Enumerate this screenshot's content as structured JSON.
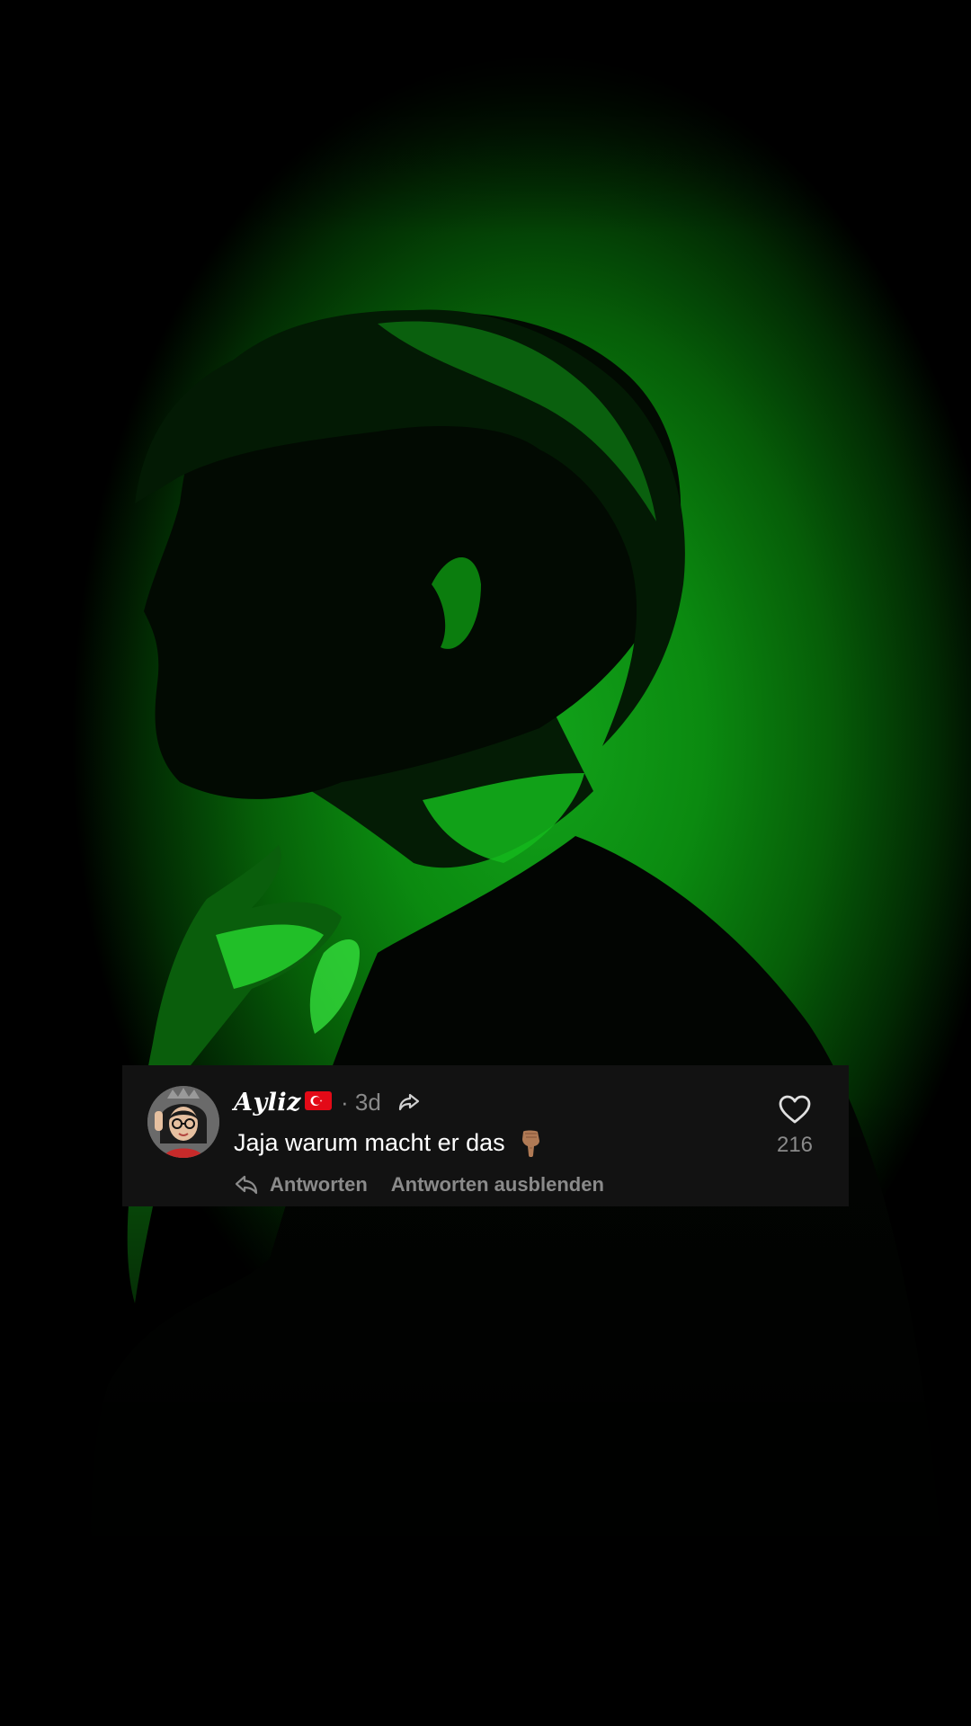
{
  "comment": {
    "username": "𝑨𝒚𝒍𝒊𝒛",
    "timestamp": "· 3d",
    "text": "Jaja warum macht er das",
    "reply_label": "Antworten",
    "hide_replies_label": "Antworten ausblenden",
    "like_count": "216",
    "icons": {
      "avatar": "avatar-bitmoji",
      "flag": "turkey-flag-icon",
      "share": "share-arrow-icon",
      "emoji": "hand-pointing-down-emoji",
      "reply": "reply-arrow-icon",
      "like": "heart-outline-icon"
    }
  },
  "colors": {
    "background_glow": "#0b8a10",
    "card_background": "#121212",
    "primary_text": "#ffffff",
    "secondary_text": "#8a8a8a"
  }
}
